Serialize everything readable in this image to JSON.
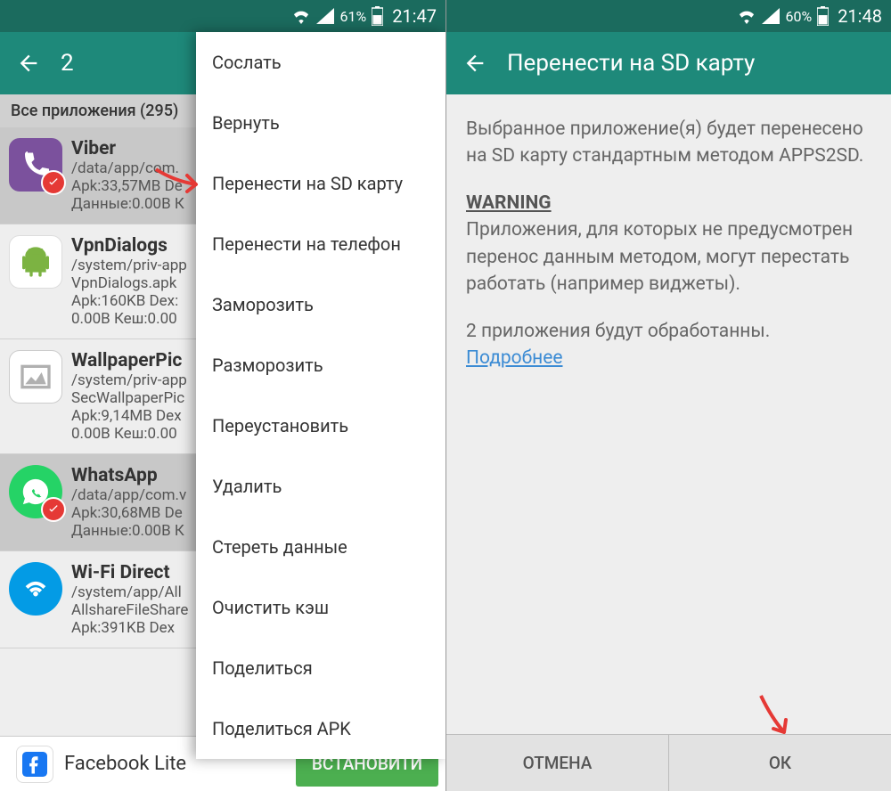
{
  "left": {
    "status": {
      "battery": "61%",
      "time": "21:47"
    },
    "appbar": {
      "count": "2"
    },
    "section": "Все приложения (295)",
    "apps": [
      {
        "name": "Viber",
        "path": "/data/app/com.",
        "line1": "Apk:33,57MB  De",
        "line2": "Данные:0.00B  К",
        "selected": true,
        "iconBg": "#7b519d"
      },
      {
        "name": "VpnDialogs",
        "path": "/system/priv-app",
        "path2": "VpnDialogs.apk",
        "line1": "Apk:160KB  Dex:",
        "line2": "0.00B  Кеш:0.00",
        "selected": false,
        "iconBg": "#fff"
      },
      {
        "name": "WallpaperPic",
        "path": "/system/priv-app",
        "path2": "SecWallpaperPic",
        "line1": "Apk:9,14MB  Dex",
        "line2": "0.00B  Кеш:0.00",
        "selected": false,
        "iconBg": "#fff"
      },
      {
        "name": "WhatsApp",
        "path": "/data/app/com.v",
        "line1": "Apk:30,68MB  De",
        "line2": "Данные:0.00B  К",
        "selected": true,
        "iconBg": "#25d366"
      },
      {
        "name": "Wi-Fi Direct",
        "path": "/system/app/All",
        "path2": "AllshareFileShare",
        "line1": "Apk:391KB  Dex",
        "selected": false,
        "iconBg": "#039be5"
      }
    ],
    "menu": [
      "Сослать",
      "Вернуть",
      "Перенести на SD карту",
      "Перенести на телефон",
      "Заморозить",
      "Разморозить",
      "Переустановить",
      "Удалить",
      "Стереть данные",
      "Очистить кэш",
      "Поделиться",
      "Поделиться APK"
    ],
    "ad": {
      "text": "Facebook Lite",
      "button": "ВСТАНОВИТИ"
    }
  },
  "right": {
    "status": {
      "battery": "60%",
      "time": "21:48"
    },
    "appbar": {
      "title": "Перенести на SD карту"
    },
    "body": {
      "p1": "Выбранное приложение(я) будет перенесено на SD карту стандартным методом APPS2SD.",
      "warning_label": "WARNING",
      "p2": "Приложения, для которых не предусмотрен перенос данным методом, могут перестать работать (например виджеты).",
      "p3": "2 приложения будут обработанны.",
      "link": "Подробнее"
    },
    "buttons": {
      "cancel": "ОТМЕНА",
      "ok": "ОК"
    }
  }
}
